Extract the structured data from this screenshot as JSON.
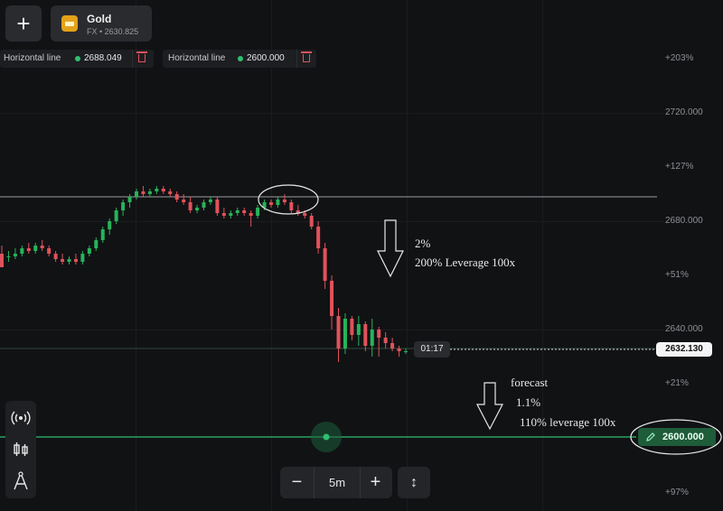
{
  "header": {
    "add_label": "+",
    "asset_name": "Gold",
    "asset_sub": "FX • 2630.825",
    "asset_icon": "gold-bar-icon"
  },
  "horizontal_lines": [
    {
      "label": "Horizontal line",
      "value": "2688.049"
    },
    {
      "label": "Horizontal line",
      "value": "2600.000"
    }
  ],
  "price_axis": {
    "labels": [
      "+203%",
      "2720.000",
      "+127%",
      "2680.000",
      "+51%",
      "2640.000",
      "+21%",
      "+97%"
    ]
  },
  "current_price": "2632.130",
  "timer": "01:17",
  "order_line": {
    "value": "2600.000",
    "icon": "pencil-icon"
  },
  "tools": [
    "broadcast-icon",
    "candles-icon",
    "drawing-icon"
  ],
  "zoom": {
    "minus": "−",
    "value": "5m",
    "plus": "+",
    "resize": "↕"
  },
  "annotations": {
    "down1_pct": "2%",
    "down1_text": "200% Leverage 100x",
    "forecast": "forecast",
    "forecast_pct": "1.1%",
    "forecast_text": "110% leverage 100x"
  },
  "colors": {
    "up": "#27b35a",
    "down": "#e0525b",
    "order": "#2fbf71",
    "background": "#111214"
  },
  "chart_data": {
    "type": "candlestick",
    "price_range": [
      2594,
      2742
    ],
    "horizontal_lines": [
      2688.049,
      2600.0
    ],
    "current_price": 2632.13,
    "candles": [
      [
        2668,
        2671,
        2665,
        2663
      ],
      [
        2667,
        2669,
        2665,
        2667
      ],
      [
        2667,
        2670,
        2666,
        2668
      ],
      [
        2668,
        2671,
        2667,
        2670
      ],
      [
        2670,
        2672,
        2668,
        2669
      ],
      [
        2669,
        2672,
        2668,
        2671
      ],
      [
        2671,
        2673,
        2669,
        2670
      ],
      [
        2670,
        2671,
        2667,
        2668
      ],
      [
        2668,
        2669,
        2665,
        2666
      ],
      [
        2666,
        2668,
        2664,
        2665
      ],
      [
        2665,
        2667,
        2664,
        2666
      ],
      [
        2666,
        2668,
        2664,
        2665
      ],
      [
        2665,
        2669,
        2664,
        2668
      ],
      [
        2668,
        2671,
        2667,
        2670
      ],
      [
        2670,
        2674,
        2669,
        2673
      ],
      [
        2673,
        2678,
        2672,
        2677
      ],
      [
        2677,
        2681,
        2675,
        2680
      ],
      [
        2680,
        2685,
        2679,
        2684
      ],
      [
        2684,
        2688,
        2682,
        2687
      ],
      [
        2687,
        2690,
        2685,
        2689
      ],
      [
        2689,
        2692,
        2688,
        2691
      ],
      [
        2691,
        2693,
        2689,
        2690
      ],
      [
        2690,
        2692,
        2689,
        2691
      ],
      [
        2691,
        2693,
        2690,
        2692
      ],
      [
        2692,
        2693,
        2690,
        2691
      ],
      [
        2691,
        2692,
        2689,
        2690
      ],
      [
        2690,
        2691,
        2687,
        2688
      ],
      [
        2688,
        2690,
        2686,
        2687
      ],
      [
        2687,
        2689,
        2683,
        2684
      ],
      [
        2684,
        2686,
        2683,
        2685
      ],
      [
        2685,
        2688,
        2684,
        2687
      ],
      [
        2687,
        2689,
        2686,
        2688
      ],
      [
        2688,
        2689,
        2682,
        2683
      ],
      [
        2683,
        2685,
        2681,
        2682
      ],
      [
        2682,
        2684,
        2681,
        2683
      ],
      [
        2683,
        2685,
        2682,
        2684
      ],
      [
        2684,
        2685,
        2682,
        2683
      ],
      [
        2683,
        2684,
        2678,
        2682
      ],
      [
        2682,
        2686,
        2681,
        2685
      ],
      [
        2685,
        2688,
        2684,
        2687
      ],
      [
        2687,
        2688,
        2685,
        2686
      ],
      [
        2686,
        2689,
        2685,
        2688
      ],
      [
        2688,
        2690,
        2686,
        2687
      ],
      [
        2687,
        2688,
        2683,
        2684
      ],
      [
        2684,
        2686,
        2682,
        2683
      ],
      [
        2683,
        2684,
        2681,
        2682
      ],
      [
        2682,
        2683,
        2677,
        2678
      ],
      [
        2678,
        2680,
        2668,
        2670
      ],
      [
        2670,
        2672,
        2655,
        2658
      ],
      [
        2658,
        2660,
        2640,
        2645
      ],
      [
        2645,
        2648,
        2628,
        2633
      ],
      [
        2633,
        2646,
        2631,
        2644
      ],
      [
        2644,
        2645,
        2636,
        2638
      ],
      [
        2638,
        2645,
        2634,
        2642
      ],
      [
        2642,
        2643,
        2632,
        2634
      ],
      [
        2634,
        2644,
        2630,
        2640
      ],
      [
        2640,
        2641,
        2630,
        2637
      ],
      [
        2637,
        2639,
        2633,
        2635
      ],
      [
        2635,
        2637,
        2632,
        2633
      ],
      [
        2633,
        2634,
        2630,
        2632
      ],
      [
        2632,
        2633,
        2631,
        2632
      ]
    ]
  }
}
